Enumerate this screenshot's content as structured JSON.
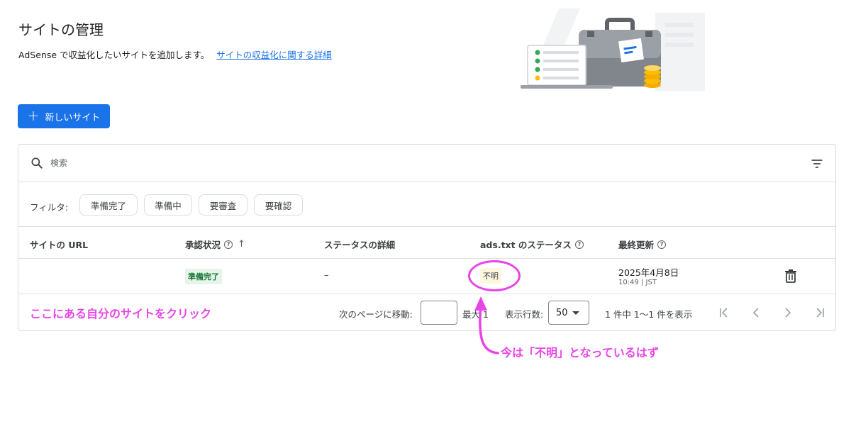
{
  "header": {
    "title": "サイトの管理",
    "description": "AdSense で収益化したいサイトを追加します。",
    "link_text": "サイトの収益化に関する詳細"
  },
  "toolbar": {
    "new_site_label": "新しいサイト"
  },
  "search": {
    "placeholder": "検索"
  },
  "filters": {
    "label": "フィルタ:",
    "chips": [
      "準備完了",
      "準備中",
      "要審査",
      "要確認"
    ]
  },
  "table": {
    "columns": [
      "サイトの URL",
      "承認状況",
      "ステータスの詳細",
      "ads.txt のステータス",
      "最終更新"
    ],
    "rows": [
      {
        "url": "",
        "status": "準備完了",
        "status_detail": "–",
        "ads_txt": "不明",
        "updated_date": "2025年4月8日",
        "updated_time": "10:49 | JST"
      }
    ]
  },
  "pagination": {
    "goto_label": "次のページに移動:",
    "goto_value": "",
    "max_label": "最大 1",
    "rows_label": "表示行数:",
    "rows_value": "50",
    "count_label": "1 件中 1〜1 件を表示"
  },
  "annotations": {
    "click_hint": "ここにある自分のサイトをクリック",
    "status_hint": "今は「不明」となっているはず"
  },
  "colors": {
    "primary": "#1a73e8",
    "annotation": "#e844e8",
    "ready_bg": "#e6f4ea",
    "ready_text": "#137333",
    "unknown_bg": "#fef7e0"
  }
}
